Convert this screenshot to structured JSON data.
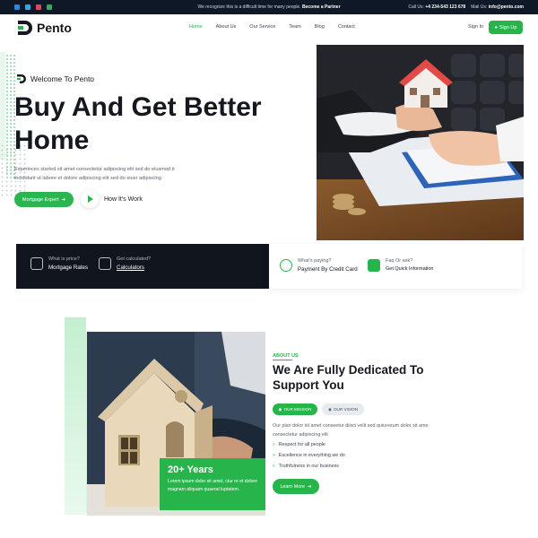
{
  "topbar": {
    "notice_text": "We recognize this is a difficult time for many people.",
    "notice_link": "Become a Partner",
    "call_label": "Call Us:",
    "call_value": "+4 234-543 123 678",
    "mail_label": "Mail Us:",
    "mail_value": "info@pento.com",
    "social_icons": [
      "facebook-icon",
      "twitter-icon",
      "pinterest-icon",
      "instagram-icon"
    ]
  },
  "header": {
    "brand": "Pento",
    "nav": [
      "Home",
      "About Us",
      "Our Service",
      "Team",
      "Blog",
      "Contact"
    ],
    "active_nav": "Home",
    "signin": "Sign In",
    "signup": "Sign Up"
  },
  "hero": {
    "welcome": "Welcome To Pento",
    "title_line1": "Buy And Get Better",
    "title_line2": "Home",
    "desc_line1": "Experinces started sit amet consectetur adipiscing elit sed do eiusmod tr",
    "desc_line2": "incididunt ut labore et dolore adipiscing elit sed do eiusr adipiscing",
    "primary_button": "Mortgage Expert",
    "video_link": "How It's Work"
  },
  "strip": {
    "items": [
      {
        "title": "What is price?",
        "value": "Mortgage Rates",
        "icon": "money-icon"
      },
      {
        "title": "Get calculated?",
        "value": "Calculators",
        "icon": "calculator-icon"
      },
      {
        "title": "What's paying?",
        "value": "Payment By Credit Card",
        "icon": "dollar-icon"
      },
      {
        "title": "Faq Or ask?",
        "value": "Get Quick Information",
        "icon": "person-icon"
      }
    ]
  },
  "about": {
    "years_title": "20+ Years",
    "years_desc": "Lorem ipsum dolor sit amet, ctur re et dolore magnam aliquam quaerat luptatem.",
    "tag": "ABOUT US",
    "title_line1": "We Are Fully Dedicated To",
    "title_line2": "Support You",
    "tabs": [
      "OUR MISSION",
      "OUR VISION"
    ],
    "desc": "Our plan dolor sit amet conseetur diisci velit sed quiuresum dolor sit ame consectetur adipiscing elit",
    "features": [
      "Respect for all people",
      "Excellence in everything we do",
      "Truthfulness in our business"
    ],
    "button": "Learn More"
  },
  "colors": {
    "brand_green": "#27b44a",
    "dark_navy": "#11151d",
    "text_dark": "#15181e"
  }
}
